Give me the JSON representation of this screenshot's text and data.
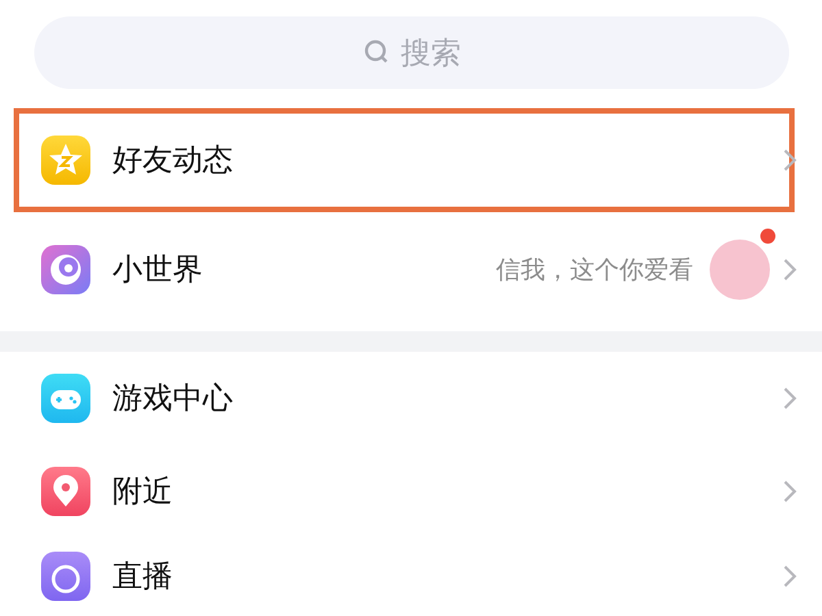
{
  "search": {
    "placeholder": "搜索"
  },
  "sections": [
    {
      "items": [
        {
          "label": "好友动态",
          "kind": "star",
          "highlighted": true,
          "sticker": false,
          "unread_dot": false
        },
        {
          "label": "小世界",
          "kind": "planet",
          "highlighted": false,
          "subtitle": "信我，这个你爱看",
          "sticker": true,
          "unread_dot": true
        }
      ]
    },
    {
      "items": [
        {
          "label": "游戏中心",
          "kind": "gamepad",
          "highlighted": false,
          "sticker": false,
          "unread_dot": false
        },
        {
          "label": "附近",
          "kind": "pin",
          "highlighted": false,
          "sticker": false,
          "unread_dot": false
        },
        {
          "label": "直播",
          "kind": "live",
          "highlighted": false,
          "sticker": false,
          "unread_dot": false
        }
      ]
    }
  ]
}
